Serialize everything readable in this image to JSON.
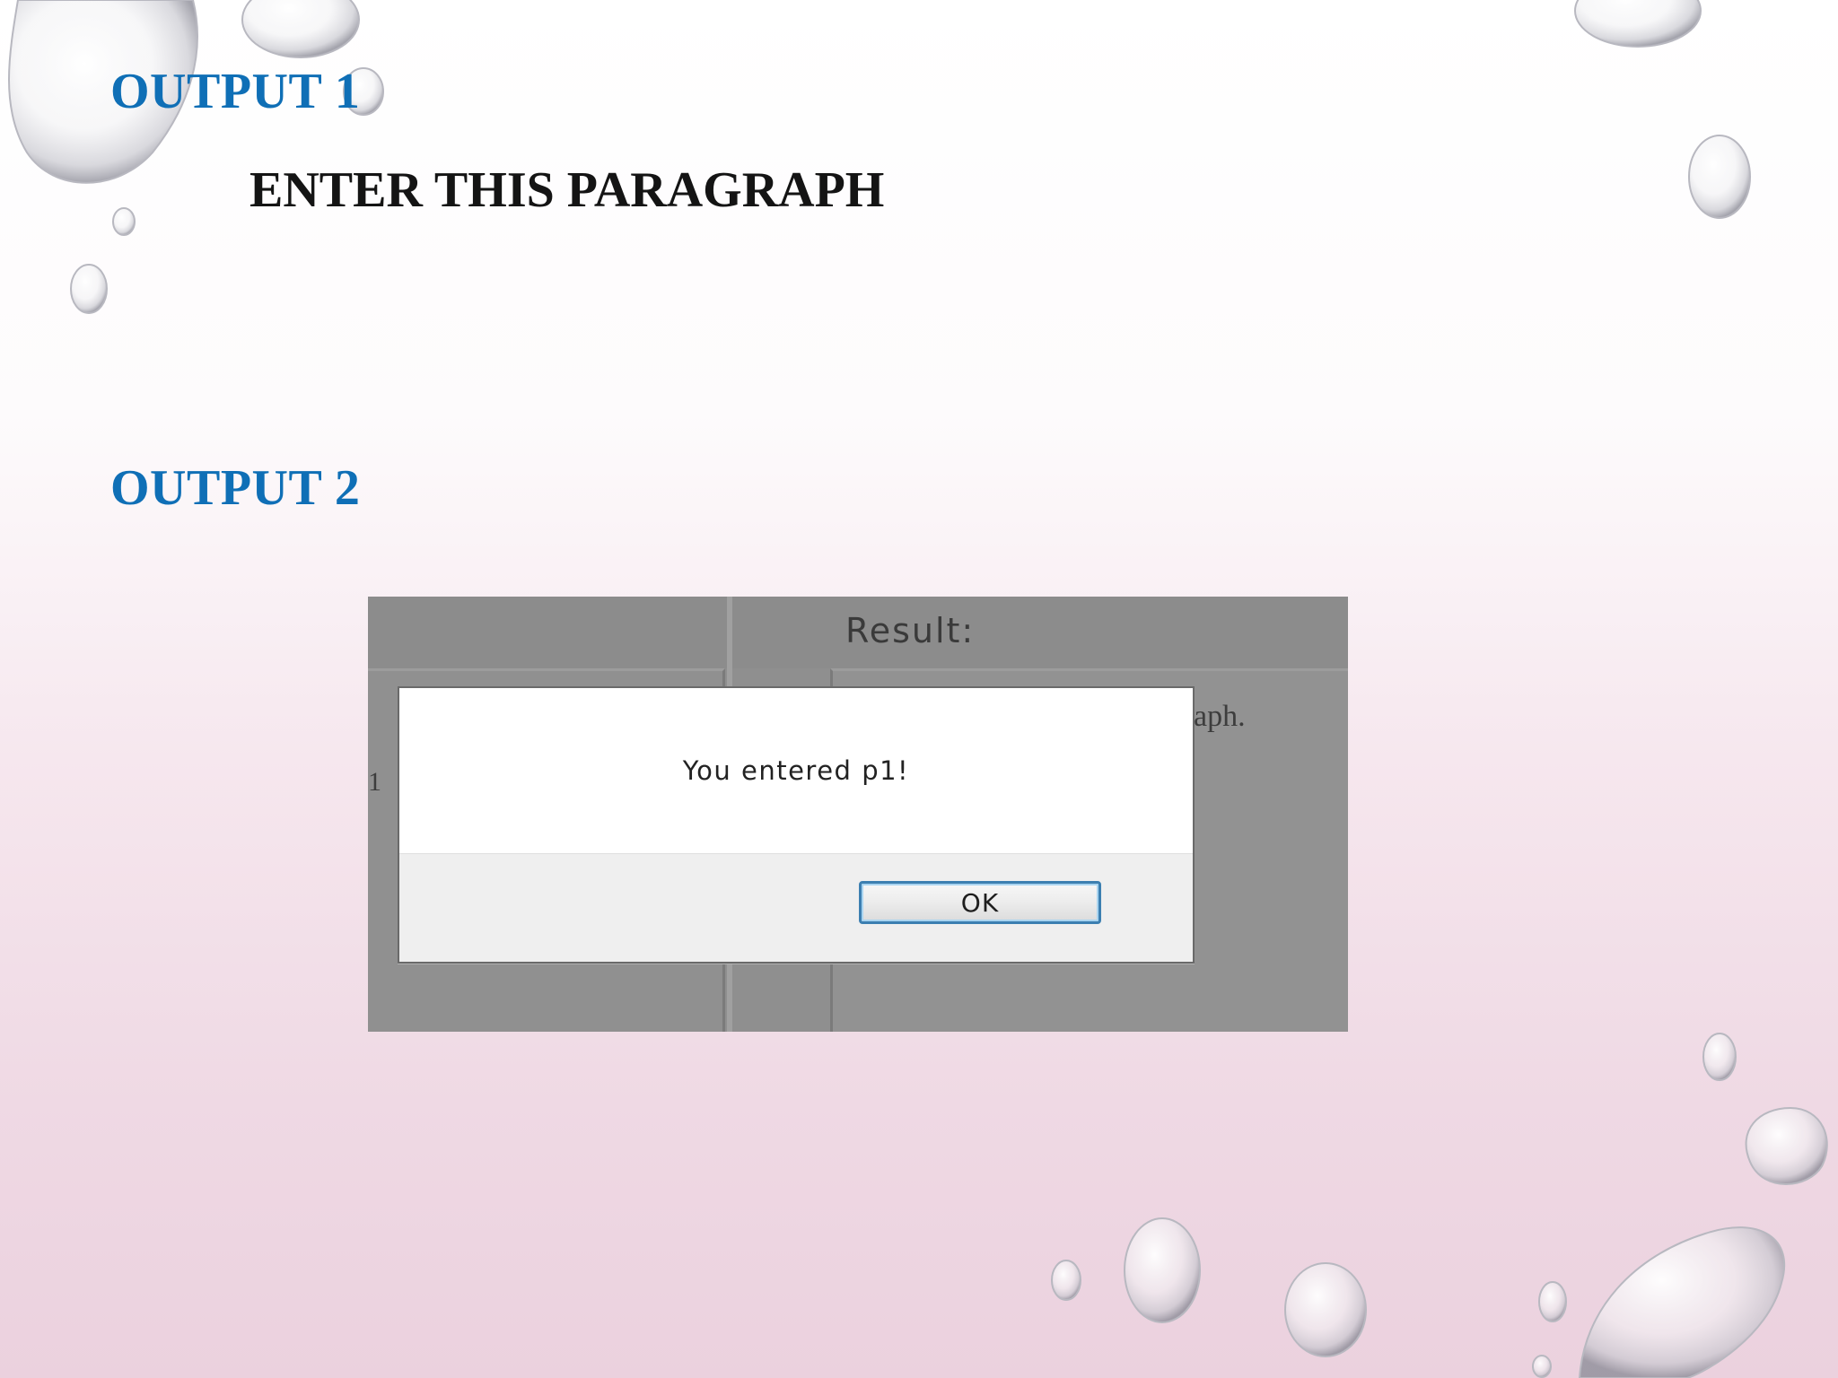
{
  "slide": {
    "heading1": "OUTPUT 1",
    "paragraph": "ENTER THIS PARAGRAPH",
    "heading2": "OUTPUT 2",
    "colors": {
      "heading": "#0f6fb6",
      "paragraph": "#141414",
      "background_bottom": "#ebd1de"
    },
    "decoration": "water-droplets"
  },
  "screenshot": {
    "result_label": "Result:",
    "partial_text_right": "aph.",
    "partial_text_left": "1",
    "dialog": {
      "message": "You entered p1!",
      "ok_label": "OK"
    }
  }
}
